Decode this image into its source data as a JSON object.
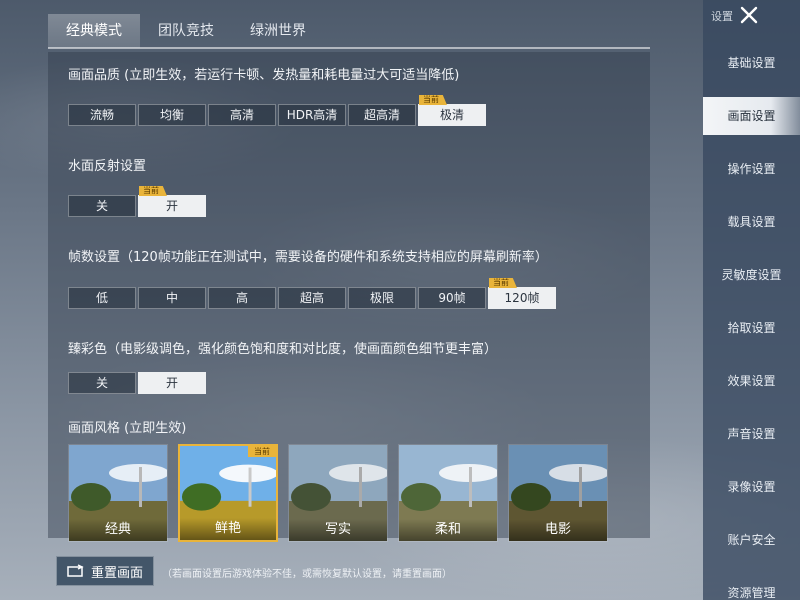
{
  "tabs": [
    {
      "label": "经典模式",
      "active": true
    },
    {
      "label": "团队竞技",
      "active": false
    },
    {
      "label": "绿洲世界",
      "active": false
    }
  ],
  "current_badge": "当前",
  "graphics_quality": {
    "title": "画面品质 (立即生效，若运行卡顿、发热量和耗电量过大可适当降低)",
    "options": [
      "流畅",
      "均衡",
      "高清",
      "HDR高清",
      "超高清",
      "极清"
    ],
    "selected_index": 5
  },
  "water_reflection": {
    "title": "水面反射设置",
    "options": [
      "关",
      "开"
    ],
    "selected_index": 1
  },
  "frame_rate": {
    "title": "帧数设置（120帧功能正在测试中，需要设备的硬件和系统支持相应的屏幕刷新率）",
    "options": [
      "低",
      "中",
      "高",
      "超高",
      "极限",
      "90帧",
      "120帧"
    ],
    "selected_index": 6
  },
  "vivid_color": {
    "title": "臻彩色（电影级调色，强化颜色饱和度和对比度，使画面颜色细节更丰富）",
    "options": [
      "关",
      "开"
    ],
    "selected_index": 1
  },
  "graphics_style": {
    "title": "画面风格 (立即生效)",
    "options": [
      "经典",
      "鲜艳",
      "写实",
      "柔和",
      "电影"
    ],
    "selected_index": 1
  },
  "reset": {
    "label": "重置画面",
    "note": "（若画面设置后游戏体验不佳，或需恢复默认设置，请重置画面）"
  },
  "sidebar": {
    "header": "设置",
    "items": [
      {
        "label": "基础设置",
        "active": false
      },
      {
        "label": "画面设置",
        "active": true
      },
      {
        "label": "操作设置",
        "active": false
      },
      {
        "label": "载具设置",
        "active": false
      },
      {
        "label": "灵敏度设置",
        "active": false
      },
      {
        "label": "拾取设置",
        "active": false
      },
      {
        "label": "效果设置",
        "active": false
      },
      {
        "label": "声音设置",
        "active": false
      },
      {
        "label": "录像设置",
        "active": false
      },
      {
        "label": "账户安全",
        "active": false
      },
      {
        "label": "资源管理",
        "active": false
      }
    ]
  },
  "colors": {
    "accent_badge": "#e9b43a",
    "selected_option": "#eef0f2",
    "sidebar_active": "#f3f5f7"
  }
}
